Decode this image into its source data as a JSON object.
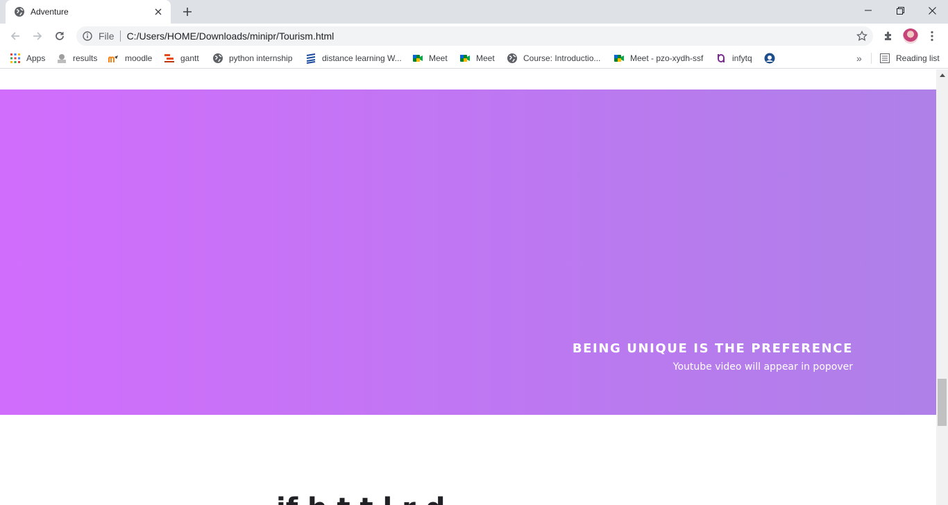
{
  "browser": {
    "tab": {
      "title": "Adventure"
    },
    "omnibox": {
      "scheme": "File",
      "url": "C:/Users/HOME/Downloads/minipr/Tourism.html"
    },
    "bookmarks": [
      {
        "label": "Apps",
        "icon": "apps-grid-icon"
      },
      {
        "label": "results",
        "icon": "results-site-icon"
      },
      {
        "label": "moodle",
        "icon": "moodle-icon"
      },
      {
        "label": "gantt",
        "icon": "gantt-icon"
      },
      {
        "label": "python internship",
        "icon": "globe-icon"
      },
      {
        "label": "distance learning W...",
        "icon": "stack-icon"
      },
      {
        "label": "Meet",
        "icon": "google-meet-icon"
      },
      {
        "label": "Meet",
        "icon": "google-meet-icon"
      },
      {
        "label": "Course: Introductio...",
        "icon": "globe-icon"
      },
      {
        "label": "Meet - pzo-xydh-ssf",
        "icon": "google-meet-icon"
      },
      {
        "label": "infytq",
        "icon": "infytq-icon"
      },
      {
        "label": "",
        "icon": "blue-circle-site-icon"
      }
    ],
    "overflow_label": "»",
    "reading_list": "Reading list"
  },
  "page": {
    "hero": {
      "title": "BEING UNIQUE IS THE PREFERENCE",
      "subtitle": "Youtube video will appear in popover",
      "gradient": [
        "#d16dfd",
        "#ae80e8"
      ]
    },
    "next_heading_partial": "if                   h  t  t  l      r      d"
  }
}
